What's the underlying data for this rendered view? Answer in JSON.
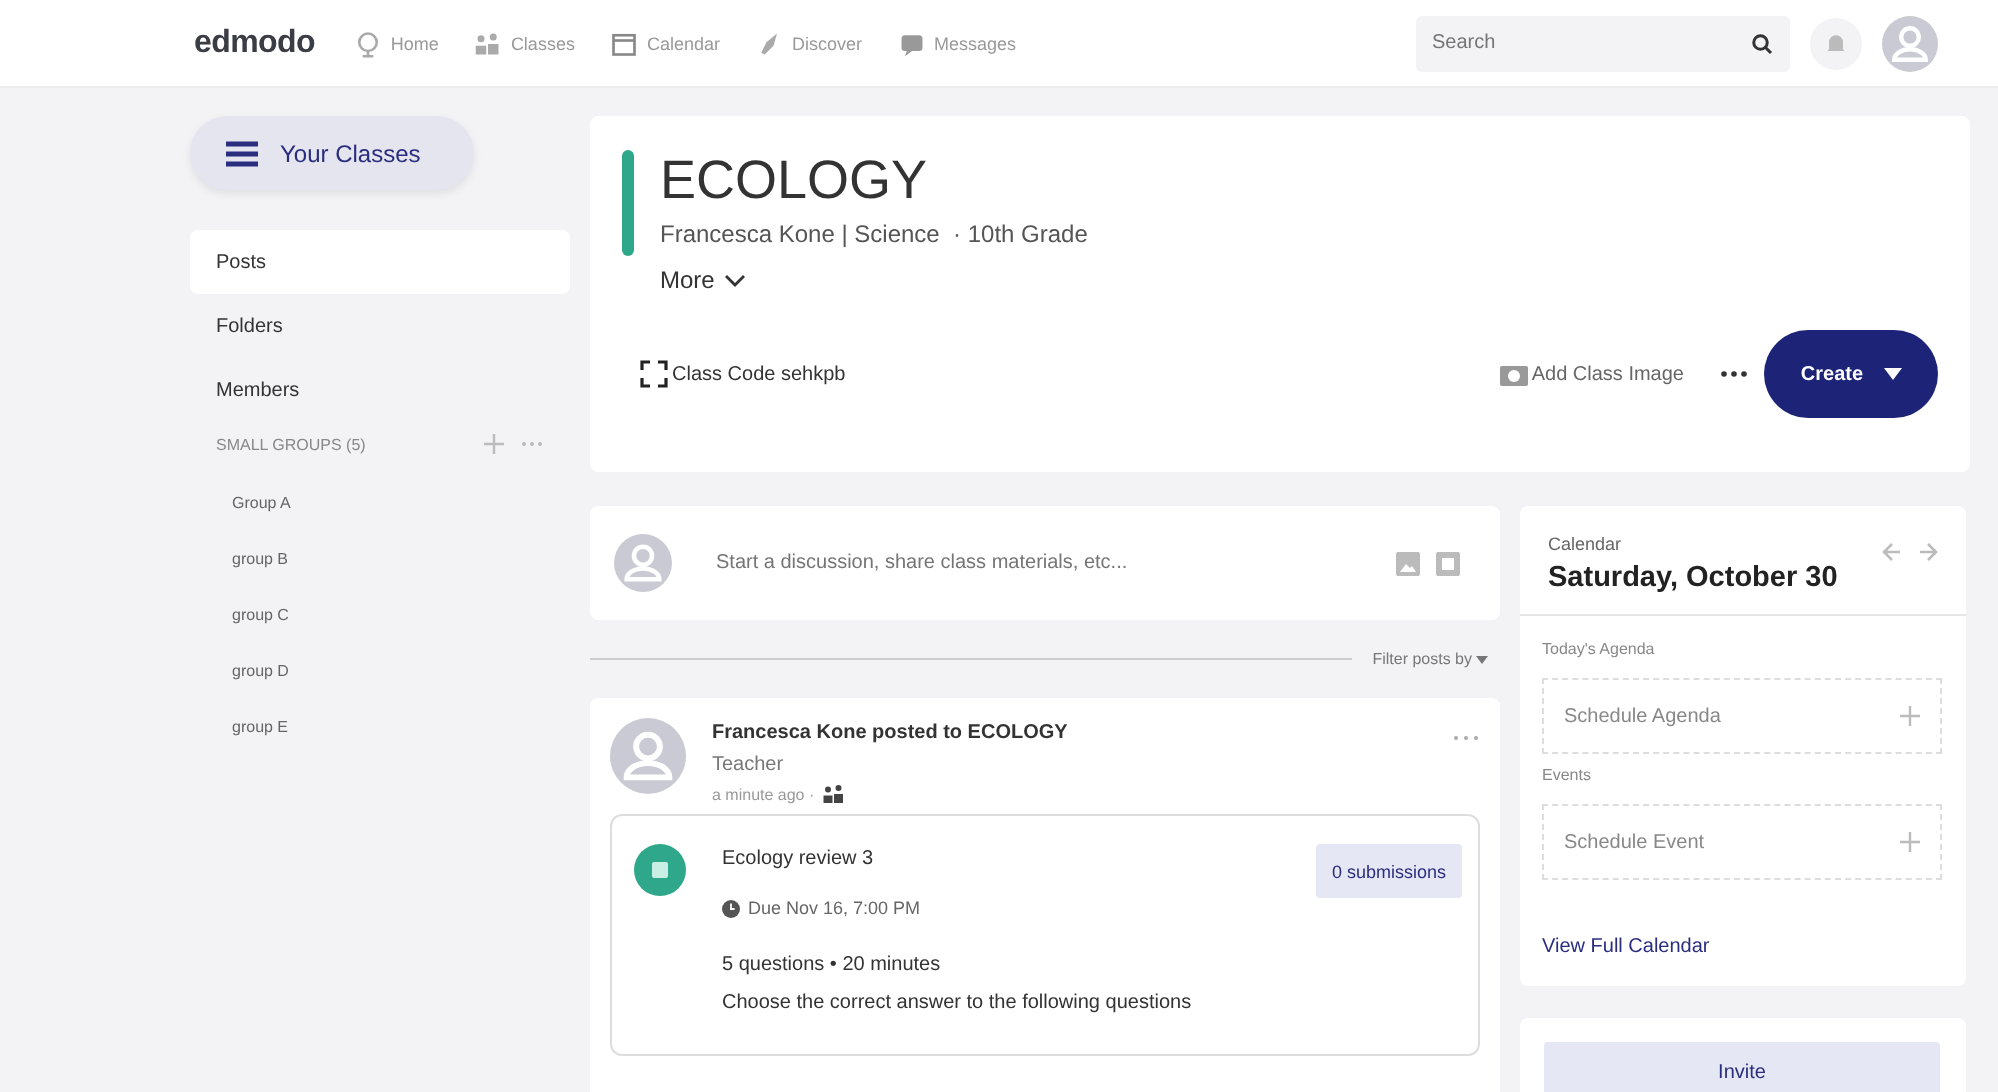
{
  "nav": {
    "logo": "edmodo",
    "items": [
      {
        "label": "Home"
      },
      {
        "label": "Classes"
      },
      {
        "label": "Calendar"
      },
      {
        "label": "Discover"
      },
      {
        "label": "Messages"
      }
    ],
    "search": {
      "placeholder": "Search"
    }
  },
  "sidebar": {
    "your_classes": "Your Classes",
    "items": [
      {
        "label": "Posts",
        "selected": true
      },
      {
        "label": "Folders",
        "selected": false
      },
      {
        "label": "Members",
        "selected": false
      }
    ],
    "groups_heading": "SMALL GROUPS (5)",
    "groups": [
      {
        "label": "Group A"
      },
      {
        "label": "group B"
      },
      {
        "label": "group C"
      },
      {
        "label": "group D"
      },
      {
        "label": "group E"
      }
    ]
  },
  "class_header": {
    "title": "ECOLOGY",
    "color": "#2fa78a",
    "subtitle": "Francesca Kone | Science  · 10th Grade",
    "more": "More",
    "class_code": "Class Code sehkpb",
    "add_image": "Add Class Image",
    "create": "Create"
  },
  "composer": {
    "placeholder": "Start a discussion, share class materials, etc..."
  },
  "filter": "Filter posts by",
  "post": {
    "author_line": "Francesca Kone posted to ECOLOGY",
    "role": "Teacher",
    "time": "a minute ago ·",
    "assignment": {
      "title": "Ecology review 3",
      "submissions": "0 submissions",
      "due": "Due Nov 16, 7:00 PM",
      "meta": "5 questions • 20 minutes",
      "description": "Choose the correct answer to the following questions"
    }
  },
  "calendar": {
    "label": "Calendar",
    "date": "Saturday, October 30",
    "agenda_heading": "Today's Agenda",
    "agenda_button": "Schedule Agenda",
    "events_heading": "Events",
    "event_button": "Schedule Event",
    "view_full": "View Full Calendar"
  },
  "invite": "Invite"
}
